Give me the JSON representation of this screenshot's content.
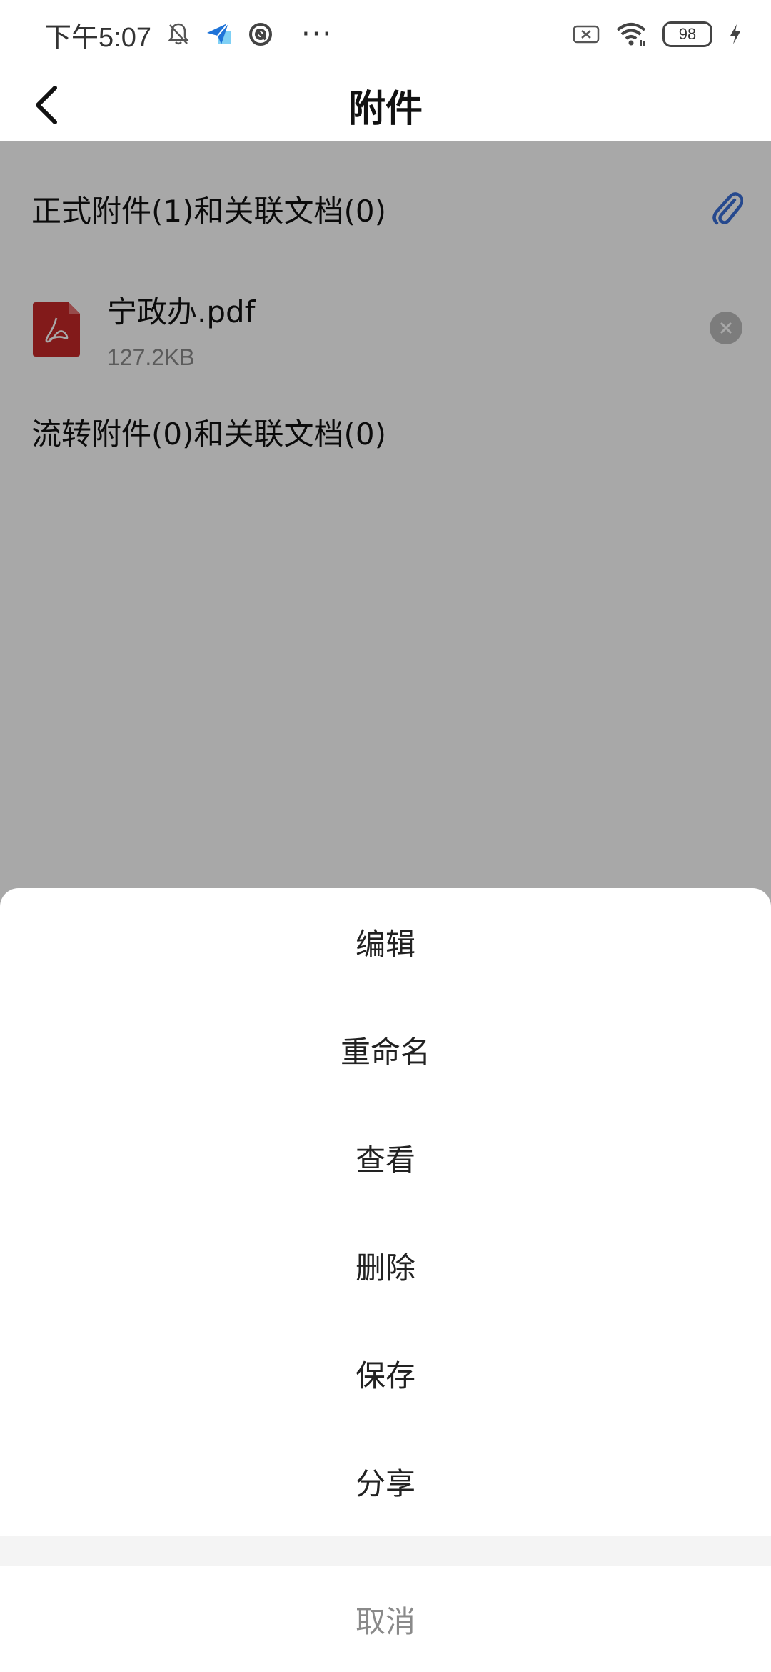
{
  "status_bar": {
    "time": "下午5:07",
    "more": "···",
    "battery": "98"
  },
  "nav": {
    "title": "附件"
  },
  "formal_section": {
    "title": "正式附件(1)和关联文档(0)",
    "files": [
      {
        "name": "宁政办.pdf",
        "size": "127.2KB"
      }
    ]
  },
  "flow_section": {
    "title": "流转附件(0)和关联文档(0)"
  },
  "action_sheet": {
    "items": [
      "编辑",
      "重命名",
      "查看",
      "删除",
      "保存",
      "分享"
    ],
    "cancel": "取消"
  },
  "colors": {
    "accent": "#3a6fd8",
    "pdf": "#c62828",
    "overlay": "rgba(0,0,0,0.34)"
  }
}
